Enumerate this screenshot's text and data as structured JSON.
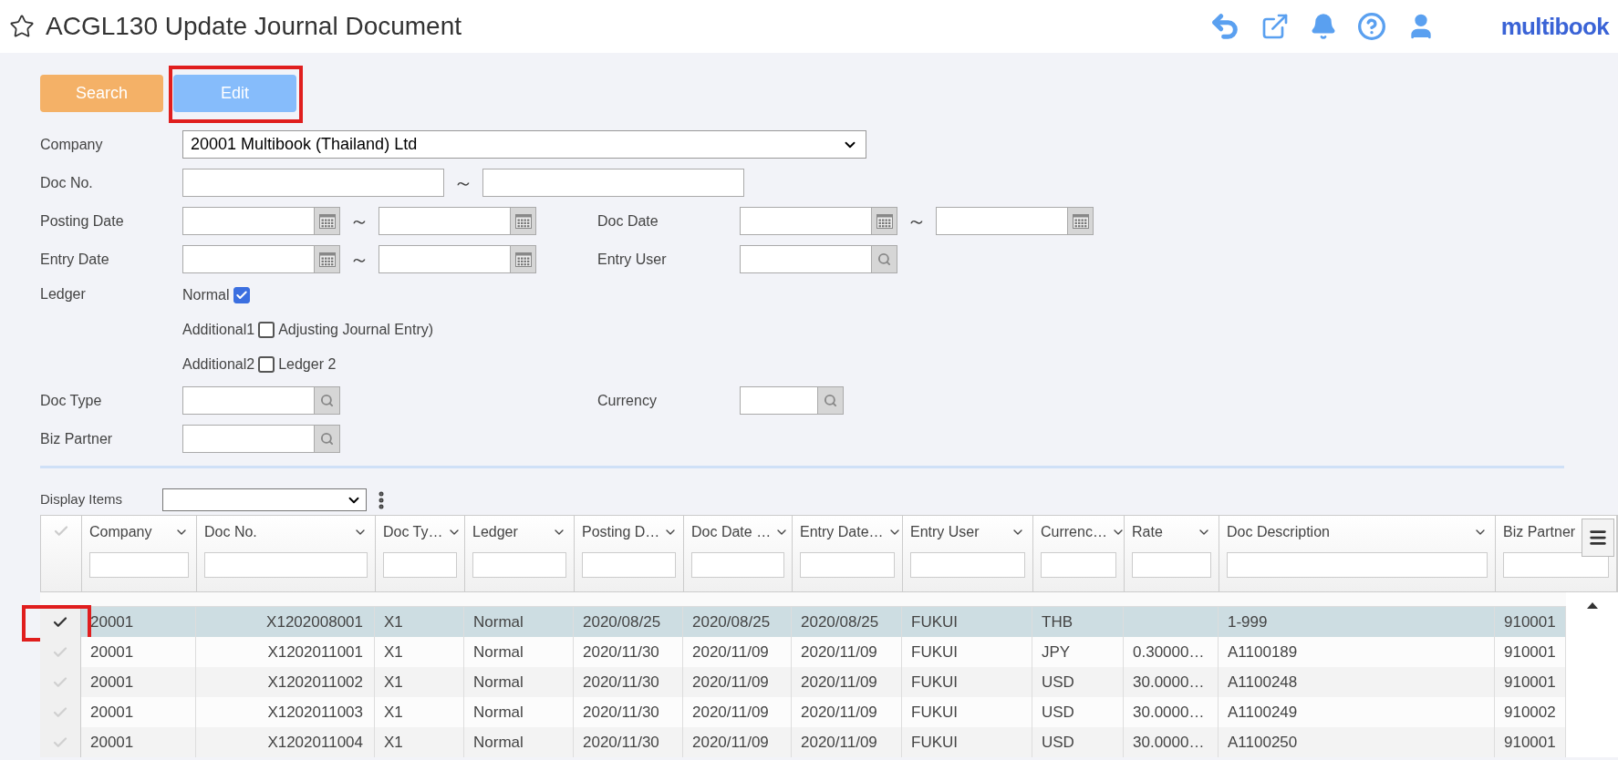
{
  "header": {
    "title": "ACGL130 Update Journal Document",
    "favorite": false,
    "logo": "multibook"
  },
  "actions": [
    {
      "label": "Search",
      "kind": "search",
      "highlighted": false
    },
    {
      "label": "Edit",
      "kind": "edit",
      "highlighted": true
    }
  ],
  "form": [
    {
      "fields": [
        {
          "kind": "select",
          "label": "Company",
          "value": "20001 Multibook (Thailand) Ltd"
        }
      ]
    },
    {
      "fields": [
        {
          "kind": "range",
          "label": "Doc No.",
          "separator": "～"
        }
      ]
    },
    {
      "fields": [
        {
          "kind": "date_range",
          "label": "Posting Date",
          "separator": "～"
        },
        {
          "kind": "date_range",
          "label": "Doc Date",
          "separator": "～"
        }
      ]
    },
    {
      "fields": [
        {
          "kind": "date_range",
          "label": "Entry Date",
          "separator": "～"
        },
        {
          "kind": "lookup",
          "label": "Entry User"
        }
      ]
    },
    {
      "fields": [
        {
          "kind": "checks",
          "label": "Ledger",
          "options": [
            {
              "name": "Normal",
              "checked": true
            },
            {
              "name": "Additional1",
              "checked": false,
              "description": "Adjusting Journal Entry)"
            },
            {
              "name": "Additional2",
              "checked": false,
              "description": "Ledger 2"
            }
          ]
        }
      ]
    },
    {
      "fields": [
        {
          "kind": "lookup",
          "label": "Doc Type"
        },
        {
          "kind": "short_lookup",
          "label": "Currency"
        }
      ]
    },
    {
      "fields": [
        {
          "kind": "lookup",
          "label": "Biz Partner"
        }
      ]
    }
  ],
  "display_items": {
    "label": "Display Items"
  },
  "table": {
    "columns": [
      "Company",
      "Doc No.",
      "Doc Ty…",
      "Ledger",
      "Posting D…",
      "Doc Date …",
      "Entry Date…",
      "Entry User",
      "Currenc…",
      "Rate",
      "Doc Description",
      "Biz Partner"
    ],
    "rows": [
      {
        "selected": true,
        "highlighted": true,
        "cells": [
          "20001",
          "X1202008001",
          "X1",
          "Normal",
          "2020/08/25",
          "2020/08/25",
          "2020/08/25",
          "FUKUI",
          "THB",
          "",
          "1-999",
          "910001"
        ]
      },
      {
        "selected": false,
        "highlighted": false,
        "cells": [
          "20001",
          "X1202011001",
          "X1",
          "Normal",
          "2020/11/30",
          "2020/11/09",
          "2020/11/09",
          "FUKUI",
          "JPY",
          "0.30000…",
          "A1100189",
          "910001"
        ]
      },
      {
        "selected": false,
        "highlighted": false,
        "cells": [
          "20001",
          "X1202011002",
          "X1",
          "Normal",
          "2020/11/30",
          "2020/11/09",
          "2020/11/09",
          "FUKUI",
          "USD",
          "30.0000…",
          "A1100248",
          "910001"
        ]
      },
      {
        "selected": false,
        "highlighted": false,
        "cells": [
          "20001",
          "X1202011003",
          "X1",
          "Normal",
          "2020/11/30",
          "2020/11/09",
          "2020/11/09",
          "FUKUI",
          "USD",
          "30.0000…",
          "A1100249",
          "910002"
        ]
      },
      {
        "selected": false,
        "highlighted": false,
        "cells": [
          "20001",
          "X1202011004",
          "X1",
          "Normal",
          "2020/11/30",
          "2020/11/09",
          "2020/11/09",
          "FUKUI",
          "USD",
          "30.0000…",
          "A1100250",
          "910001"
        ]
      }
    ]
  }
}
